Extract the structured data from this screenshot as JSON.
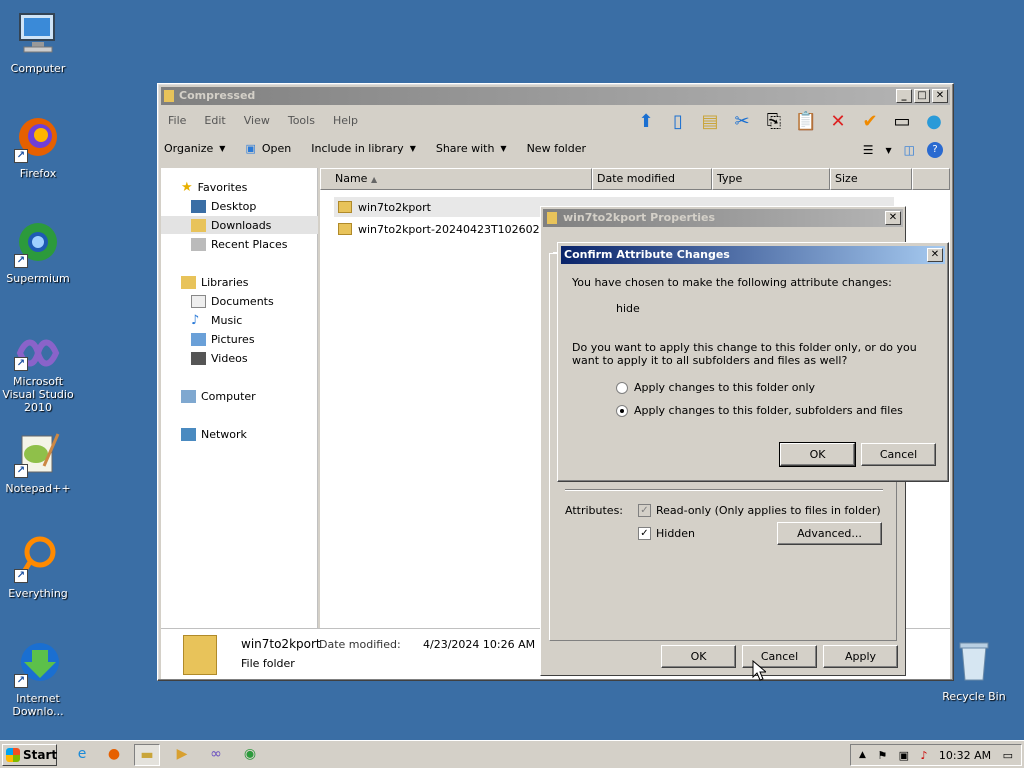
{
  "desktop": {
    "icons": [
      {
        "label": "Computer",
        "glyph": "🖥"
      },
      {
        "label": "Firefox",
        "glyph": "🦊"
      },
      {
        "label": "Supermium",
        "glyph": "🌐"
      },
      {
        "label": "Microsoft Visual Studio 2010",
        "glyph": "∞"
      },
      {
        "label": "Notepad++",
        "glyph": "📝"
      },
      {
        "label": "Everything",
        "glyph": "○"
      },
      {
        "label": "Internet Downlo...",
        "glyph": "⬇"
      },
      {
        "label": "Recycle Bin",
        "glyph": "🗑"
      }
    ]
  },
  "explorer": {
    "title": "Compressed",
    "menu": [
      "File",
      "Edit",
      "View",
      "Tools",
      "Help"
    ],
    "commands": {
      "organize": "Organize",
      "open": "Open",
      "include": "Include in library",
      "share": "Share with",
      "newfolder": "New folder"
    },
    "nav": {
      "favorites": "Favorites",
      "desktop": "Desktop",
      "downloads": "Downloads",
      "recent": "Recent Places",
      "libraries": "Libraries",
      "documents": "Documents",
      "music": "Music",
      "pictures": "Pictures",
      "videos": "Videos",
      "computer": "Computer",
      "network": "Network"
    },
    "columns": {
      "name": "Name",
      "date": "Date modified",
      "type": "Type",
      "size": "Size"
    },
    "files": [
      "win7to2kport",
      "win7to2kport-20240423T102602Z-001"
    ],
    "details": {
      "name": "win7to2kport",
      "date_label": "Date modified:",
      "date": "4/23/2024 10:26 AM",
      "type": "File folder"
    }
  },
  "properties": {
    "title": "win7to2kport Properties",
    "attributes_label": "Attributes:",
    "readonly": "Read-only (Only applies to files in folder)",
    "hidden": "Hidden",
    "advanced": "Advanced...",
    "ok": "OK",
    "cancel": "Cancel",
    "apply": "Apply"
  },
  "confirm": {
    "title": "Confirm Attribute Changes",
    "intro": "You have chosen to make the following attribute changes:",
    "change": "hide",
    "question": "Do you want to apply this change to this folder only, or do you want to apply it to all subfolders and files as well?",
    "option1": "Apply changes to this folder only",
    "option2": "Apply changes to this folder, subfolders and files",
    "ok": "OK",
    "cancel": "Cancel"
  },
  "taskbar": {
    "start": "Start",
    "time": "10:32 AM"
  }
}
